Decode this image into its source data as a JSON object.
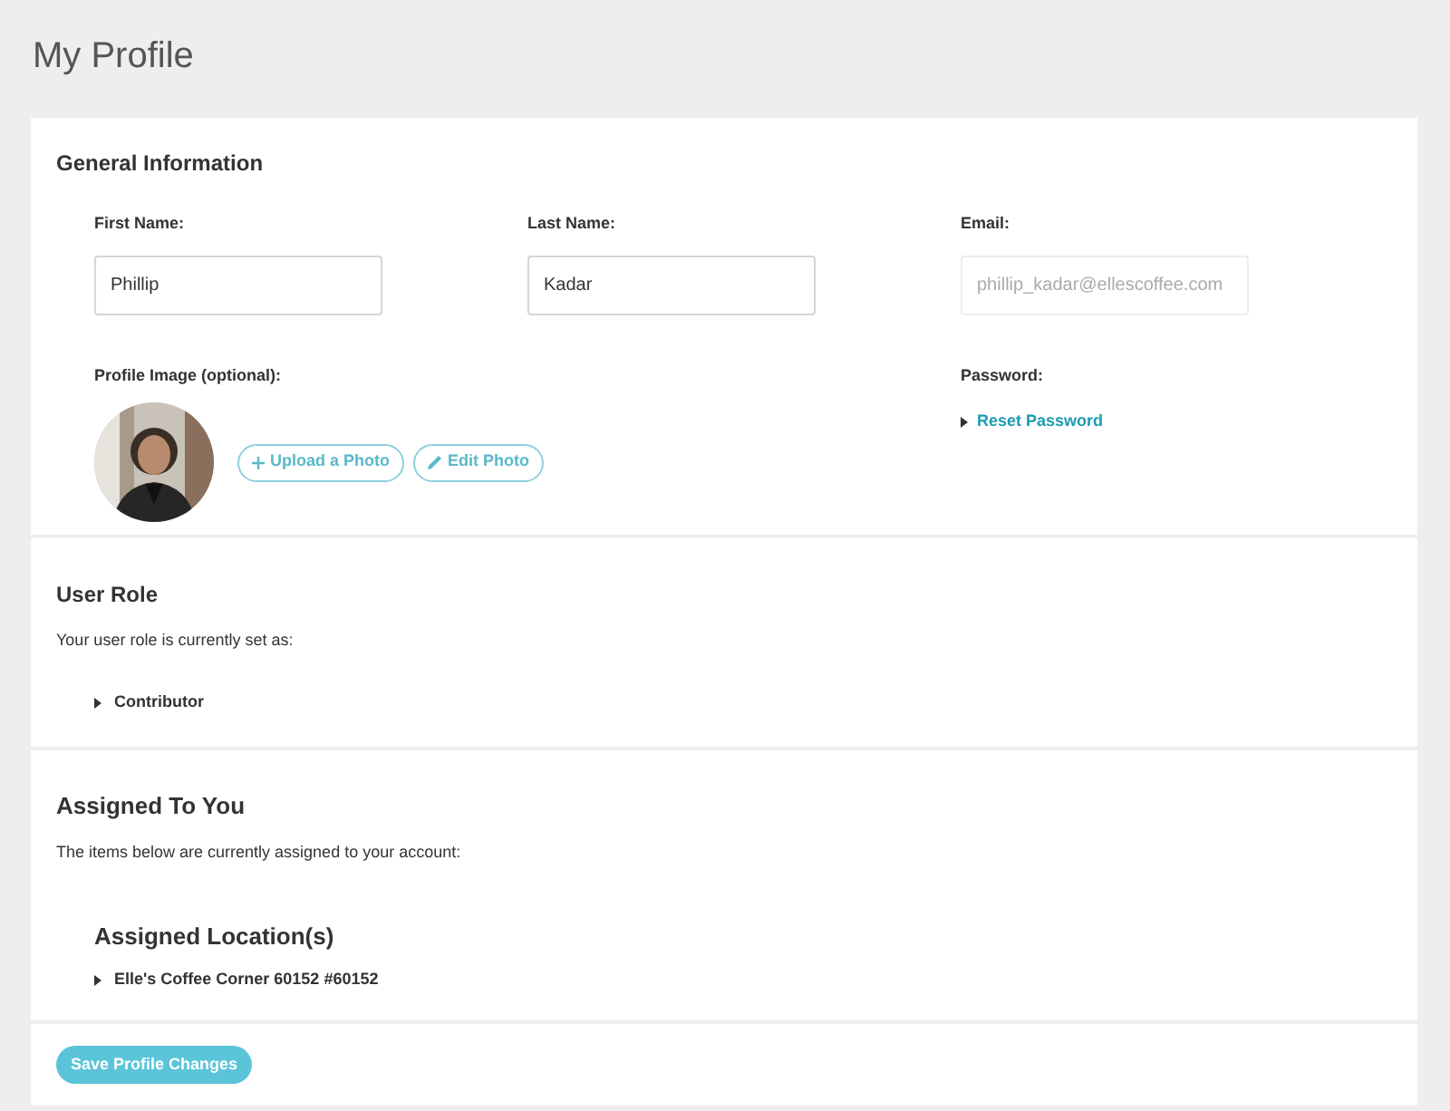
{
  "page_title": "My Profile",
  "general": {
    "heading": "General Information",
    "fields": [
      {
        "label": "First Name:",
        "value": "Phillip",
        "disabled": false
      },
      {
        "label": "Last Name:",
        "value": "Kadar",
        "disabled": false
      },
      {
        "label": "Email:",
        "value": "phillip_kadar@ellescoffee.com",
        "disabled": true
      }
    ],
    "profile_image": {
      "label": "Profile Image (optional):",
      "buttons": [
        {
          "kind": "upload",
          "label": "Upload a Photo"
        },
        {
          "kind": "edit",
          "label": "Edit Photo"
        }
      ]
    },
    "password": {
      "label": "Password:",
      "link": "Reset Password"
    }
  },
  "user_role": {
    "heading": "User Role",
    "description": "Your user role is currently set as:",
    "items": [
      "Contributor"
    ]
  },
  "assigned": {
    "heading": "Assigned To You",
    "description": "The items below are currently assigned to your account:",
    "subheading": "Assigned Location(s)",
    "items": [
      "Elle's Coffee Corner 60152 #60152"
    ]
  },
  "save_button": "Save Profile Changes"
}
